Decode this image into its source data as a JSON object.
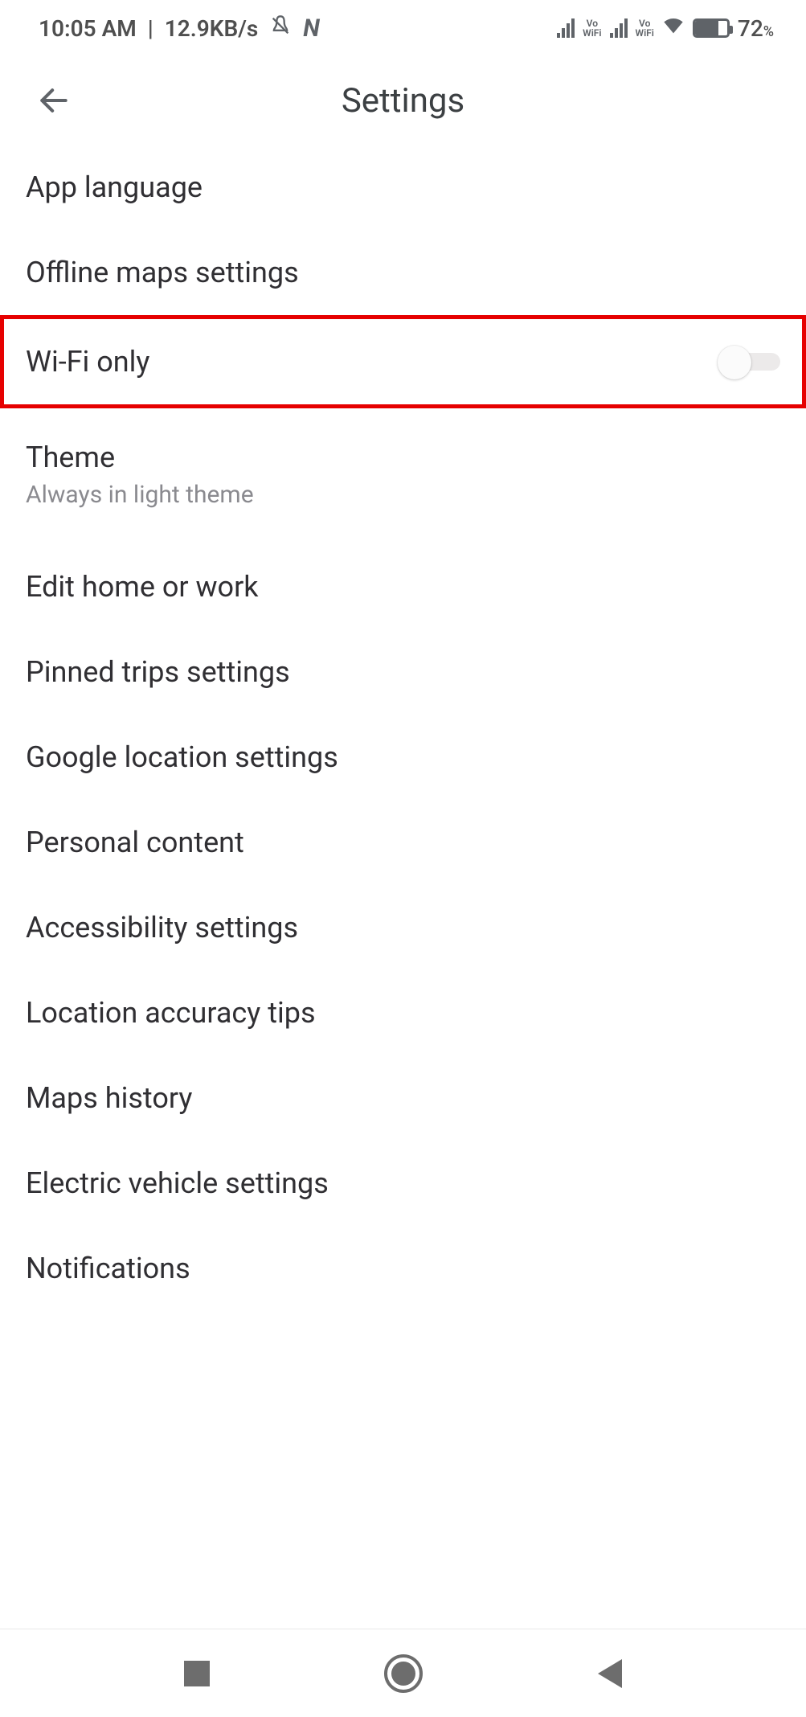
{
  "status": {
    "time": "10:05 AM",
    "speed": "12.9KB/s",
    "battery_text": "72",
    "battery_pct_symbol": "%"
  },
  "header": {
    "title": "Settings"
  },
  "rows": {
    "app_language": "App language",
    "offline_maps": "Offline maps settings",
    "wifi_only": "Wi-Fi only",
    "theme_title": "Theme",
    "theme_sub": "Always in light theme",
    "edit_home_work": "Edit home or work",
    "pinned_trips": "Pinned trips settings",
    "google_location": "Google location settings",
    "personal_content": "Personal content",
    "accessibility": "Accessibility settings",
    "location_tips": "Location accuracy tips",
    "maps_history": "Maps history",
    "ev_settings": "Electric vehicle settings",
    "notifications": "Notifications"
  },
  "wifi_only_toggle_on": false
}
